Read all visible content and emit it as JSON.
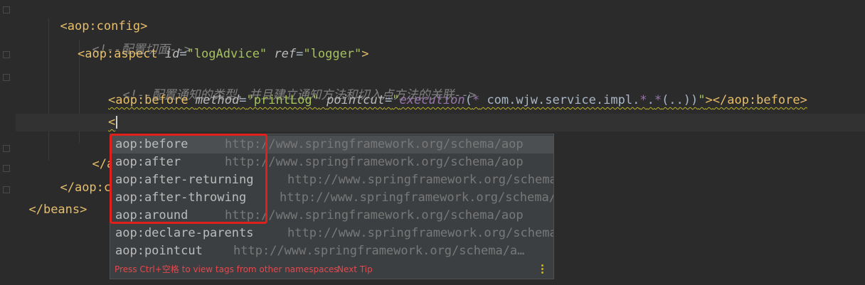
{
  "editor": {
    "lines": {
      "config_open": "<aop:config>",
      "comment_aspect": "<!--配置切面-->",
      "aspect_open_tag": "<aop:aspect",
      "aspect_attr_id": "id",
      "aspect_val_id": "\"logAdvice\"",
      "aspect_attr_ref": "ref",
      "aspect_val_ref": "\"logger\"",
      "aspect_close_bracket": ">",
      "comment_notify": "<!--配置通知的类型，并且建立通知方法和切入点方法的关联-->",
      "before_open": "<aop:before",
      "before_attr_method": "method",
      "before_val_method": "\"printLog\"",
      "before_attr_pointcut": "pointcut",
      "before_val_q": "\"",
      "before_val_exec": "execution",
      "before_val_paren": "(",
      "before_val_star": "*",
      "before_val_pkg": " com.wjw.service.impl.",
      "before_val_star2": "*",
      "before_val_dot": ".",
      "before_val_star3": "*",
      "before_val_args": "(..))",
      "before_val_endq": "\"",
      "before_gt": ">",
      "before_close": "</aop:before>",
      "typing": "<",
      "aspect_close_partial": "</ao",
      "config_close_partial": "</aop:co",
      "beans_close": "</beans>"
    }
  },
  "completion": {
    "items": [
      {
        "name": "aop:before",
        "url": "http://www.springframework.org/schema/aop"
      },
      {
        "name": "aop:after",
        "url": "http://www.springframework.org/schema/aop"
      },
      {
        "name": "aop:after-returning",
        "url": "http://www.springframework.org/schema/s…"
      },
      {
        "name": "aop:after-throwing",
        "url": "http://www.springframework.org/schema/sc…"
      },
      {
        "name": "aop:around",
        "url": "http://www.springframework.org/schema/aop"
      },
      {
        "name": "aop:declare-parents",
        "url": "http://www.springframework.org/schema/s…"
      },
      {
        "name": "aop:pointcut",
        "url": "http://www.springframework.org/schema/a…"
      }
    ],
    "footer_hint": "Press Ctrl+空格 to view tags from other namespaces",
    "footer_tip": "Next Tip",
    "more_icon": "vertical-ellipsis-icon"
  },
  "colors": {
    "background": "#2b2b2b",
    "tag": "#e8bf6a",
    "string": "#a5c25c",
    "comment": "#808080",
    "highlight_box": "#e0201a",
    "footer_text": "#e5484d"
  }
}
